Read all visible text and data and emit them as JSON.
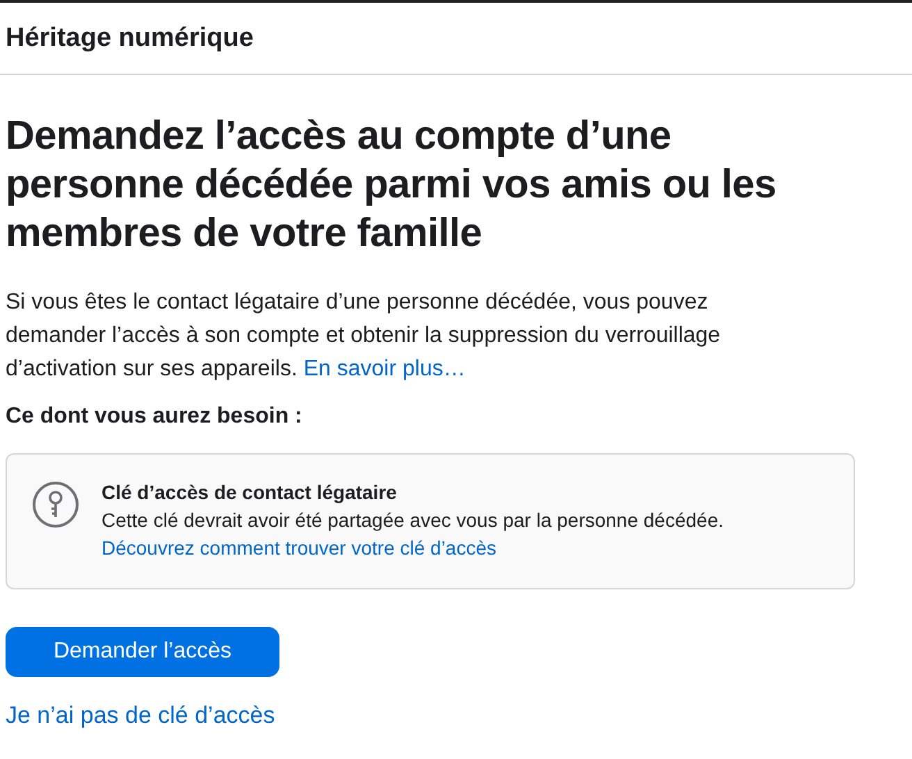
{
  "header": {
    "title": "Héritage numérique"
  },
  "heading": "Demandez l’accès au compte d’une personne décédée parmi vos amis ou les membres de votre famille",
  "intro": {
    "text": "Si vous êtes le contact légataire d’une personne décédée, vous pouvez demander l’accès à son compte et obtenir la suppression du verrouillage d’activation sur ses appareils.",
    "link": "En savoir plus…"
  },
  "requirements": {
    "title": "Ce dont vous aurez besoin :",
    "items": [
      {
        "title": "Clé d’accès de contact légataire",
        "description": "Cette clé devrait avoir été partagée avec vous par la personne décédée.",
        "link": "Découvrez comment trouver votre clé d’accès"
      }
    ]
  },
  "primary_button": "Demander l’accès",
  "secondary_link": "Je n’ai pas de clé d’accès"
}
